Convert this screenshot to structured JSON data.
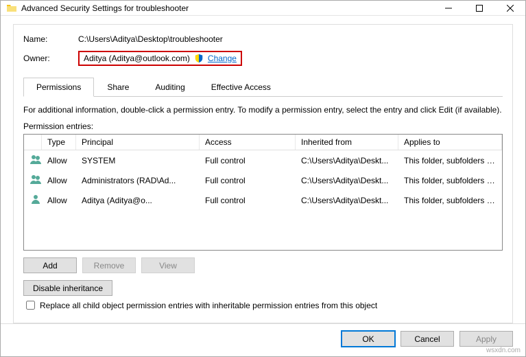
{
  "window": {
    "title": "Advanced Security Settings for troubleshooter"
  },
  "fields": {
    "name_label": "Name:",
    "name_value": "C:\\Users\\Aditya\\Desktop\\troubleshooter",
    "owner_label": "Owner:",
    "owner_value": "Aditya (Aditya@outlook.com)",
    "change_link": "Change"
  },
  "tabs": {
    "permissions": "Permissions",
    "share": "Share",
    "auditing": "Auditing",
    "effective": "Effective Access"
  },
  "info_text": "For additional information, double-click a permission entry. To modify a permission entry, select the entry and click Edit (if available).",
  "entries_label": "Permission entries:",
  "columns": {
    "type": "Type",
    "principal": "Principal",
    "access": "Access",
    "inherited": "Inherited from",
    "applies": "Applies to"
  },
  "rows": [
    {
      "icon": "users",
      "type": "Allow",
      "principal": "SYSTEM",
      "access": "Full control",
      "inherited": "C:\\Users\\Aditya\\Deskt...",
      "applies": "This folder, subfolders and files"
    },
    {
      "icon": "users",
      "type": "Allow",
      "principal": "Administrators (RAD\\Ad...",
      "access": "Full control",
      "inherited": "C:\\Users\\Aditya\\Deskt...",
      "applies": "This folder, subfolders and files"
    },
    {
      "icon": "user",
      "type": "Allow",
      "principal": "Aditya (Aditya@o...",
      "access": "Full control",
      "inherited": "C:\\Users\\Aditya\\Deskt...",
      "applies": "This folder, subfolders and files"
    }
  ],
  "buttons": {
    "add": "Add",
    "remove": "Remove",
    "view": "View",
    "disable_inh": "Disable inheritance",
    "ok": "OK",
    "cancel": "Cancel",
    "apply": "Apply"
  },
  "checkbox": "Replace all child object permission entries with inheritable permission entries from this object",
  "watermark": "wsxdn.com"
}
